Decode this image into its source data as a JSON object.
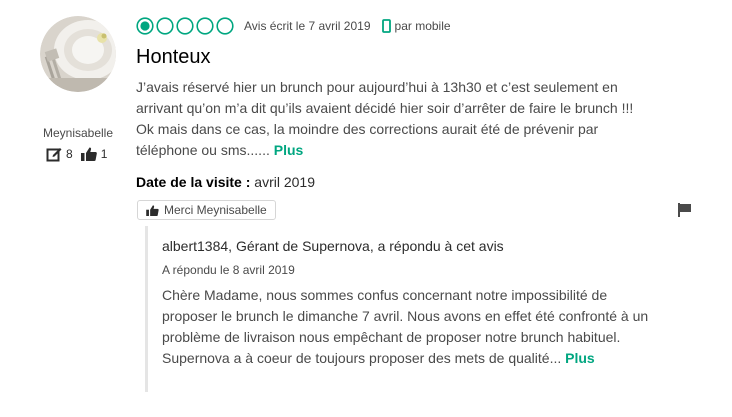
{
  "reviewer": {
    "name": "Meynisabelle",
    "reviews_count": "8",
    "helpful_votes": "1"
  },
  "review": {
    "rating": 1,
    "rating_max": 5,
    "written_date": "Avis écrit le 7 avril 2019",
    "device": "par mobile",
    "title": "Honteux",
    "text": "J’avais réservé hier un brunch pour aujourd’hui à 13h30 et c’est seulement en arrivant qu’on m’a dit qu’ils avaient décidé hier soir d’arrêter de faire le brunch !!! Ok mais dans ce cas, la moindre des corrections aurait été de prévenir par téléphone ou sms......",
    "more_label": "Plus",
    "visit_label": "Date de la visite :",
    "visit_date": "avril 2019",
    "thanks_label": "Merci Meynisabelle"
  },
  "reply": {
    "header": "albert1384, Gérant de Supernova, a répondu à cet avis",
    "date": "A répondu le 8 avril 2019",
    "text": "Chère Madame, nous sommes confus concernant notre impossibilité de proposer le brunch le dimanche 7 avril. Nous avons en effet été confronté à un problème de livraison nous empêchant de proposer notre brunch habituel. Supernova a à coeur de toujours proposer des mets de qualité...",
    "more_label": "Plus"
  },
  "colors": {
    "accent": "#00a680",
    "text": "#4a4a4a",
    "flag": "#4a4a4a"
  },
  "icons": [
    "reviewer-avatar",
    "pencil-review-icon",
    "thumbs-up-icon",
    "rating-bubble-icon",
    "mobile-phone-icon",
    "flag-icon"
  ]
}
